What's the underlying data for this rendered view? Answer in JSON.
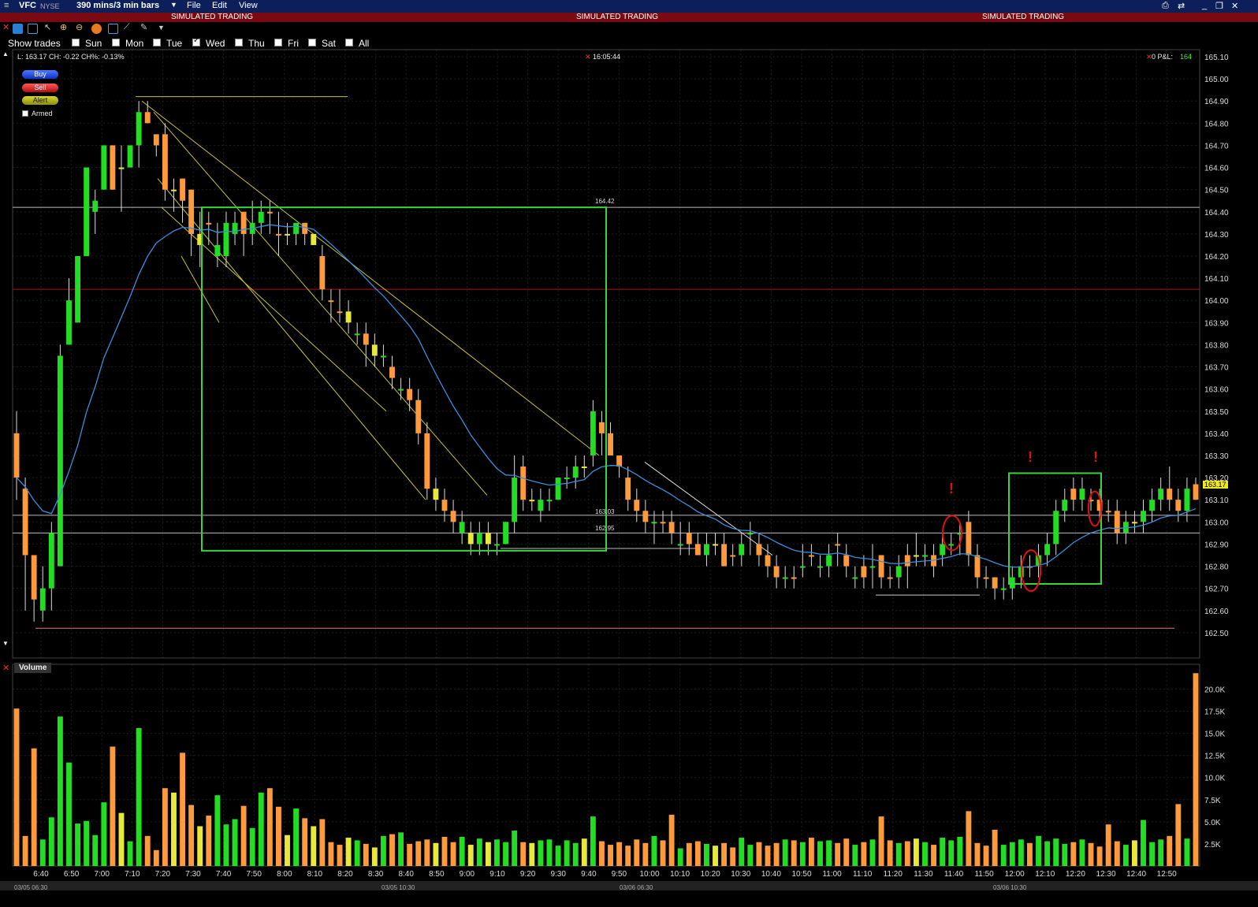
{
  "window": {
    "symbol": "VFC",
    "exchange": "NYSE",
    "bar_setting": "390 mins/3 min bars",
    "menu": [
      "File",
      "Edit",
      "View"
    ],
    "simulated_label": "SIMULATED TRADING"
  },
  "show_trades": {
    "label": "Show trades",
    "days": [
      {
        "label": "Sun",
        "checked": false
      },
      {
        "label": "Mon",
        "checked": false
      },
      {
        "label": "Tue",
        "checked": false
      },
      {
        "label": "Wed",
        "checked": true
      },
      {
        "label": "Thu",
        "checked": false
      },
      {
        "label": "Fri",
        "checked": false
      },
      {
        "label": "Sat",
        "checked": false
      },
      {
        "label": "All",
        "checked": false
      }
    ]
  },
  "quote": {
    "info": "L: 163.17  CH: -0.22  CH%: -0.13%",
    "clock": "16:05:44",
    "pnl_label": "0 P&L:",
    "pnl_value": "164"
  },
  "order_buttons": {
    "buy": "Buy",
    "sell": "Sell",
    "alert": "Alert",
    "armed": "Armed"
  },
  "volume_panel": {
    "title": "Volume"
  },
  "price_labels": {
    "box_high": "164.42",
    "level_a": "163.03",
    "level_b": "162.95",
    "last": "163.17"
  },
  "date_marks": [
    "03/05 06:30",
    "03/05 10:30",
    "03/06 06:30",
    "03/06 10:30"
  ],
  "colors": {
    "up": "#22dd22",
    "down": "#ff9a3c",
    "neutral": "#e8e83a",
    "ma": "#3a8fd9",
    "sim_bar": "#7a0a12",
    "title_bar": "#0c1f5a",
    "annot_box": "#39d639",
    "trendline": "#c9c23a",
    "marker": "#e01010"
  },
  "chart_data": {
    "type": "candlestick",
    "symbol": "VFC",
    "y_axis_ticks": [
      "165.10",
      "165.00",
      "164.90",
      "164.80",
      "164.70",
      "164.60",
      "164.50",
      "164.40",
      "164.30",
      "164.20",
      "164.10",
      "164.00",
      "163.90",
      "163.80",
      "163.70",
      "163.60",
      "163.50",
      "163.40",
      "163.30",
      "163.20",
      "163.10",
      "163.00",
      "162.90",
      "162.80",
      "162.70",
      "162.60",
      "162.50"
    ],
    "ylim": [
      162.45,
      165.12
    ],
    "x_axis_ticks": [
      "6:40",
      "6:50",
      "7:00",
      "7:10",
      "7:20",
      "7:30",
      "7:40",
      "7:50",
      "8:00",
      "8:10",
      "8:20",
      "8:30",
      "8:40",
      "8:50",
      "9:00",
      "9:10",
      "9:20",
      "9:30",
      "9:40",
      "9:50",
      "10:00",
      "10:10",
      "10:20",
      "10:30",
      "10:40",
      "10:50",
      "11:00",
      "11:10",
      "11:20",
      "11:30",
      "11:40",
      "11:50",
      "12:00",
      "12:10",
      "12:20",
      "12:30",
      "12:40",
      "12:50"
    ],
    "volume_ticks": [
      "20.0K",
      "17.5K",
      "15.0K",
      "12.5K",
      "10.0K",
      "7.5K",
      "5.0K",
      "2.5K"
    ],
    "volume_ylim": [
      0,
      22000
    ],
    "bars": [
      [
        163.4,
        163.5,
        163.1,
        163.2,
        "d",
        17800
      ],
      [
        163.15,
        163.2,
        162.6,
        162.85,
        "d",
        3400
      ],
      [
        162.85,
        162.85,
        162.55,
        162.65,
        "d",
        13300
      ],
      [
        162.6,
        162.8,
        162.55,
        162.7,
        "u",
        3000
      ],
      [
        162.7,
        163.0,
        162.6,
        162.95,
        "u",
        5500
      ],
      [
        162.8,
        163.8,
        162.8,
        163.75,
        "u",
        16900
      ],
      [
        163.8,
        164.1,
        163.8,
        164.0,
        "u",
        11700
      ],
      [
        163.9,
        164.2,
        163.9,
        164.2,
        "u",
        4800
      ],
      [
        164.2,
        164.6,
        164.2,
        164.6,
        "u",
        5100
      ],
      [
        164.4,
        164.5,
        164.3,
        164.45,
        "u",
        3500
      ],
      [
        164.5,
        164.7,
        164.5,
        164.7,
        "u",
        7200
      ],
      [
        164.7,
        164.7,
        164.5,
        164.5,
        "d",
        13500
      ],
      [
        164.6,
        164.7,
        164.4,
        164.6,
        "n",
        6000
      ],
      [
        164.6,
        164.7,
        164.6,
        164.7,
        "u",
        2800
      ],
      [
        164.7,
        164.9,
        164.6,
        164.85,
        "u",
        15600
      ],
      [
        164.85,
        164.9,
        164.8,
        164.8,
        "d",
        3400
      ],
      [
        164.75,
        164.75,
        164.65,
        164.7,
        "d",
        1800
      ],
      [
        164.75,
        164.8,
        164.45,
        164.5,
        "d",
        8800
      ],
      [
        164.5,
        164.55,
        164.4,
        164.5,
        "n",
        8300
      ],
      [
        164.55,
        164.55,
        164.35,
        164.45,
        "d",
        12800
      ],
      [
        164.5,
        164.5,
        164.2,
        164.3,
        "d",
        6900
      ],
      [
        164.3,
        164.4,
        164.15,
        164.25,
        "n",
        4500
      ],
      [
        164.35,
        164.4,
        164.25,
        164.35,
        "d",
        5700
      ],
      [
        164.25,
        164.35,
        164.15,
        164.2,
        "u",
        8000
      ],
      [
        164.2,
        164.4,
        164.15,
        164.35,
        "u",
        4700
      ],
      [
        164.35,
        164.4,
        164.25,
        164.3,
        "u",
        5300
      ],
      [
        164.3,
        164.4,
        164.2,
        164.4,
        "d",
        6800
      ],
      [
        164.3,
        164.45,
        164.25,
        164.35,
        "u",
        4300
      ],
      [
        164.35,
        164.45,
        164.3,
        164.4,
        "u",
        8300
      ],
      [
        164.4,
        164.45,
        164.3,
        164.4,
        "d",
        8800
      ],
      [
        164.3,
        164.4,
        164.2,
        164.3,
        "d",
        6700
      ],
      [
        164.3,
        164.35,
        164.25,
        164.3,
        "n",
        3500
      ],
      [
        164.3,
        164.35,
        164.25,
        164.35,
        "u",
        6500
      ],
      [
        164.35,
        164.35,
        164.25,
        164.3,
        "d",
        5400
      ],
      [
        164.3,
        164.3,
        164.25,
        164.25,
        "n",
        4500
      ],
      [
        164.2,
        164.25,
        164.0,
        164.05,
        "d",
        5300
      ],
      [
        164.0,
        164.05,
        163.9,
        164.0,
        "d",
        2700
      ],
      [
        163.95,
        164.05,
        163.9,
        163.95,
        "d",
        2400
      ],
      [
        163.95,
        164.0,
        163.85,
        163.9,
        "n",
        3200
      ],
      [
        163.85,
        163.9,
        163.8,
        163.85,
        "u",
        2900
      ],
      [
        163.85,
        163.9,
        163.7,
        163.8,
        "d",
        2500
      ],
      [
        163.8,
        163.85,
        163.7,
        163.75,
        "n",
        2100
      ],
      [
        163.75,
        163.8,
        163.7,
        163.75,
        "u",
        3400
      ],
      [
        163.7,
        163.75,
        163.6,
        163.65,
        "d",
        3600
      ],
      [
        163.6,
        163.65,
        163.55,
        163.6,
        "u",
        3800
      ],
      [
        163.6,
        163.65,
        163.5,
        163.55,
        "d",
        2500
      ],
      [
        163.55,
        163.6,
        163.35,
        163.4,
        "d",
        2800
      ],
      [
        163.4,
        163.45,
        163.1,
        163.15,
        "d",
        3000
      ],
      [
        163.15,
        163.2,
        163.05,
        163.1,
        "n",
        2600
      ],
      [
        163.1,
        163.15,
        163.0,
        163.05,
        "d",
        3300
      ],
      [
        163.05,
        163.1,
        162.95,
        163.0,
        "d",
        2700
      ],
      [
        162.95,
        163.05,
        162.9,
        163.0,
        "u",
        3300
      ],
      [
        162.95,
        163.0,
        162.85,
        162.9,
        "n",
        2400
      ],
      [
        162.9,
        163.0,
        162.85,
        162.95,
        "u",
        3100
      ],
      [
        162.95,
        163.0,
        162.85,
        162.9,
        "n",
        2700
      ],
      [
        162.9,
        162.95,
        162.85,
        162.9,
        "u",
        3000
      ],
      [
        162.9,
        163.0,
        162.9,
        163.0,
        "u",
        2700
      ],
      [
        163.0,
        163.3,
        162.95,
        163.2,
        "u",
        4000
      ],
      [
        163.25,
        163.3,
        163.05,
        163.1,
        "d",
        2700
      ],
      [
        163.1,
        163.15,
        163.05,
        163.1,
        "n",
        2600
      ],
      [
        163.05,
        163.15,
        163.0,
        163.1,
        "u",
        2900
      ],
      [
        163.1,
        163.15,
        163.05,
        163.1,
        "u",
        3000
      ],
      [
        163.1,
        163.2,
        163.1,
        163.2,
        "u",
        2300
      ],
      [
        163.2,
        163.25,
        163.15,
        163.2,
        "u",
        2900
      ],
      [
        163.2,
        163.3,
        163.15,
        163.25,
        "u",
        2600
      ],
      [
        163.25,
        163.3,
        163.2,
        163.25,
        "n",
        3100
      ],
      [
        163.3,
        163.55,
        163.25,
        163.5,
        "u",
        5600
      ],
      [
        163.45,
        163.5,
        163.3,
        163.4,
        "d",
        2800
      ],
      [
        163.4,
        163.45,
        163.3,
        163.3,
        "d",
        2400
      ],
      [
        163.3,
        163.3,
        163.2,
        163.25,
        "d",
        2700
      ],
      [
        163.2,
        163.25,
        163.05,
        163.1,
        "d",
        2300
      ],
      [
        163.1,
        163.15,
        163.0,
        163.05,
        "d",
        3000
      ],
      [
        163.05,
        163.1,
        162.95,
        163.0,
        "d",
        2600
      ],
      [
        163.0,
        163.05,
        162.9,
        163.0,
        "u",
        3400
      ],
      [
        163.0,
        163.05,
        162.95,
        163.0,
        "d",
        2900
      ],
      [
        163.0,
        163.05,
        162.9,
        162.95,
        "d",
        5800
      ],
      [
        162.9,
        163.0,
        162.85,
        162.9,
        "u",
        2000
      ],
      [
        162.95,
        163.0,
        162.85,
        162.9,
        "d",
        2600
      ],
      [
        162.9,
        162.95,
        162.85,
        162.85,
        "d",
        2800
      ],
      [
        162.85,
        162.95,
        162.8,
        162.9,
        "u",
        2500
      ],
      [
        162.9,
        162.95,
        162.85,
        162.9,
        "n",
        2300
      ],
      [
        162.9,
        162.95,
        162.8,
        162.8,
        "d",
        2600
      ],
      [
        162.85,
        162.9,
        162.8,
        162.85,
        "d",
        2100
      ],
      [
        162.85,
        162.95,
        162.8,
        162.9,
        "u",
        3200
      ],
      [
        162.95,
        163.0,
        162.85,
        162.95,
        "u",
        2400
      ],
      [
        162.9,
        162.95,
        162.8,
        162.85,
        "d",
        2700
      ],
      [
        162.85,
        162.9,
        162.75,
        162.8,
        "d",
        2300
      ],
      [
        162.8,
        162.85,
        162.7,
        162.75,
        "d",
        2600
      ],
      [
        162.75,
        162.8,
        162.7,
        162.75,
        "u",
        3000
      ],
      [
        162.75,
        162.8,
        162.7,
        162.75,
        "d",
        2900
      ],
      [
        162.8,
        162.9,
        162.75,
        162.8,
        "u",
        2700
      ],
      [
        162.85,
        162.9,
        162.8,
        162.85,
        "d",
        3200
      ],
      [
        162.8,
        162.85,
        162.75,
        162.8,
        "u",
        2800
      ],
      [
        162.8,
        162.9,
        162.75,
        162.85,
        "u",
        2900
      ],
      [
        162.9,
        162.95,
        162.8,
        162.9,
        "d",
        2600
      ],
      [
        162.85,
        162.9,
        162.75,
        162.8,
        "d",
        3100
      ],
      [
        162.75,
        162.8,
        162.7,
        162.75,
        "u",
        2400
      ],
      [
        162.75,
        162.85,
        162.7,
        162.8,
        "d",
        2700
      ],
      [
        162.8,
        162.9,
        162.7,
        162.8,
        "u",
        3000
      ],
      [
        162.85,
        162.85,
        162.7,
        162.75,
        "d",
        5600
      ],
      [
        162.75,
        162.8,
        162.7,
        162.75,
        "d",
        2900
      ],
      [
        162.75,
        162.85,
        162.7,
        162.8,
        "u",
        2600
      ],
      [
        162.8,
        162.9,
        162.7,
        162.85,
        "d",
        2800
      ],
      [
        162.85,
        162.95,
        162.8,
        162.85,
        "n",
        3100
      ],
      [
        162.85,
        162.9,
        162.8,
        162.85,
        "u",
        2700
      ],
      [
        162.8,
        162.9,
        162.75,
        162.85,
        "d",
        2400
      ],
      [
        162.85,
        162.95,
        162.8,
        162.9,
        "u",
        3200
      ],
      [
        162.9,
        162.95,
        162.85,
        162.9,
        "u",
        2900
      ],
      [
        162.95,
        163.0,
        162.85,
        162.95,
        "u",
        3300
      ],
      [
        163.0,
        163.05,
        162.8,
        162.85,
        "d",
        6200
      ],
      [
        162.85,
        162.9,
        162.7,
        162.75,
        "d",
        2600
      ],
      [
        162.75,
        162.8,
        162.7,
        162.75,
        "d",
        2300
      ],
      [
        162.75,
        162.75,
        162.65,
        162.7,
        "d",
        4100
      ],
      [
        162.7,
        162.75,
        162.65,
        162.7,
        "u",
        2400
      ],
      [
        162.7,
        162.8,
        162.65,
        162.75,
        "u",
        2700
      ],
      [
        162.75,
        162.85,
        162.7,
        162.8,
        "u",
        3000
      ],
      [
        162.8,
        162.85,
        162.75,
        162.8,
        "d",
        2600
      ],
      [
        162.8,
        162.9,
        162.75,
        162.85,
        "u",
        3400
      ],
      [
        162.85,
        162.95,
        162.8,
        162.9,
        "u",
        2800
      ],
      [
        162.9,
        163.1,
        162.85,
        163.05,
        "u",
        3100
      ],
      [
        163.05,
        163.15,
        163.0,
        163.1,
        "u",
        2500
      ],
      [
        163.1,
        163.2,
        163.05,
        163.15,
        "d",
        2700
      ],
      [
        163.15,
        163.2,
        163.05,
        163.1,
        "u",
        3000
      ],
      [
        163.1,
        163.15,
        163.05,
        163.1,
        "d",
        2600
      ],
      [
        163.1,
        163.15,
        163.0,
        163.05,
        "d",
        2200
      ],
      [
        163.05,
        163.1,
        163.0,
        163.05,
        "d",
        4700
      ],
      [
        163.05,
        163.1,
        162.9,
        162.95,
        "d",
        2800
      ],
      [
        162.95,
        163.05,
        162.9,
        163.0,
        "u",
        2400
      ],
      [
        163.0,
        163.05,
        162.95,
        163.0,
        "n",
        2900
      ],
      [
        163.0,
        163.1,
        162.95,
        163.05,
        "u",
        5200
      ],
      [
        163.05,
        163.15,
        163.0,
        163.1,
        "u",
        2700
      ],
      [
        163.1,
        163.2,
        163.05,
        163.15,
        "u",
        3000
      ],
      [
        163.15,
        163.25,
        163.05,
        163.1,
        "d",
        3400
      ],
      [
        163.1,
        163.15,
        163.0,
        163.05,
        "d",
        7000
      ],
      [
        163.05,
        163.2,
        163.0,
        163.15,
        "u",
        3100
      ],
      [
        163.1,
        163.2,
        163.1,
        163.17,
        "d",
        21800
      ]
    ],
    "annotations": {
      "box_high": 164.42,
      "level_a": 163.03,
      "level_b": 162.95,
      "red_line": 164.05,
      "markers": [
        "!",
        "!",
        "!"
      ]
    }
  }
}
